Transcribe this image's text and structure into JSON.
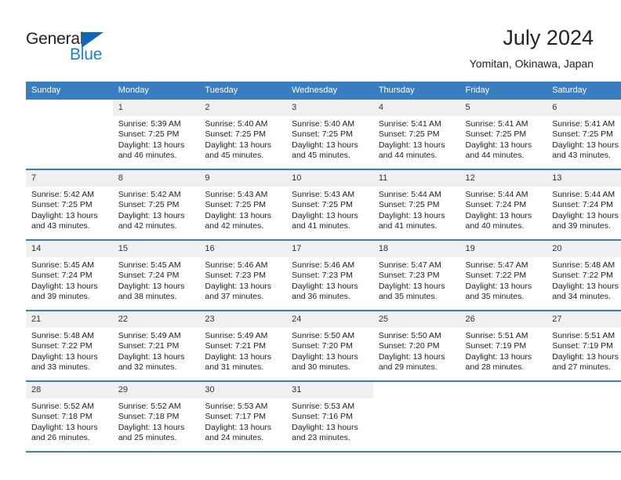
{
  "brand": {
    "name_dark": "General",
    "name_light": "Blue",
    "triangle_color": "#1267b2",
    "light_color": "#1f7fd4"
  },
  "header": {
    "title": "July 2024",
    "subtitle": "Yomitan, Okinawa, Japan"
  },
  "theme": {
    "header_blue": "#3a7dc0",
    "daynum_band": "#f0f0f0",
    "text": "#222222"
  },
  "weekdays": [
    "Sunday",
    "Monday",
    "Tuesday",
    "Wednesday",
    "Thursday",
    "Friday",
    "Saturday"
  ],
  "weeks": [
    [
      {
        "day": "",
        "blank": true,
        "sunrise": "",
        "sunset": "",
        "daylight1": "",
        "daylight2": ""
      },
      {
        "day": "1",
        "sunrise": "Sunrise: 5:39 AM",
        "sunset": "Sunset: 7:25 PM",
        "daylight1": "Daylight: 13 hours",
        "daylight2": "and 46 minutes."
      },
      {
        "day": "2",
        "sunrise": "Sunrise: 5:40 AM",
        "sunset": "Sunset: 7:25 PM",
        "daylight1": "Daylight: 13 hours",
        "daylight2": "and 45 minutes."
      },
      {
        "day": "3",
        "sunrise": "Sunrise: 5:40 AM",
        "sunset": "Sunset: 7:25 PM",
        "daylight1": "Daylight: 13 hours",
        "daylight2": "and 45 minutes."
      },
      {
        "day": "4",
        "sunrise": "Sunrise: 5:41 AM",
        "sunset": "Sunset: 7:25 PM",
        "daylight1": "Daylight: 13 hours",
        "daylight2": "and 44 minutes."
      },
      {
        "day": "5",
        "sunrise": "Sunrise: 5:41 AM",
        "sunset": "Sunset: 7:25 PM",
        "daylight1": "Daylight: 13 hours",
        "daylight2": "and 44 minutes."
      },
      {
        "day": "6",
        "sunrise": "Sunrise: 5:41 AM",
        "sunset": "Sunset: 7:25 PM",
        "daylight1": "Daylight: 13 hours",
        "daylight2": "and 43 minutes."
      }
    ],
    [
      {
        "day": "7",
        "sunrise": "Sunrise: 5:42 AM",
        "sunset": "Sunset: 7:25 PM",
        "daylight1": "Daylight: 13 hours",
        "daylight2": "and 43 minutes."
      },
      {
        "day": "8",
        "sunrise": "Sunrise: 5:42 AM",
        "sunset": "Sunset: 7:25 PM",
        "daylight1": "Daylight: 13 hours",
        "daylight2": "and 42 minutes."
      },
      {
        "day": "9",
        "sunrise": "Sunrise: 5:43 AM",
        "sunset": "Sunset: 7:25 PM",
        "daylight1": "Daylight: 13 hours",
        "daylight2": "and 42 minutes."
      },
      {
        "day": "10",
        "sunrise": "Sunrise: 5:43 AM",
        "sunset": "Sunset: 7:25 PM",
        "daylight1": "Daylight: 13 hours",
        "daylight2": "and 41 minutes."
      },
      {
        "day": "11",
        "sunrise": "Sunrise: 5:44 AM",
        "sunset": "Sunset: 7:25 PM",
        "daylight1": "Daylight: 13 hours",
        "daylight2": "and 41 minutes."
      },
      {
        "day": "12",
        "sunrise": "Sunrise: 5:44 AM",
        "sunset": "Sunset: 7:24 PM",
        "daylight1": "Daylight: 13 hours",
        "daylight2": "and 40 minutes."
      },
      {
        "day": "13",
        "sunrise": "Sunrise: 5:44 AM",
        "sunset": "Sunset: 7:24 PM",
        "daylight1": "Daylight: 13 hours",
        "daylight2": "and 39 minutes."
      }
    ],
    [
      {
        "day": "14",
        "sunrise": "Sunrise: 5:45 AM",
        "sunset": "Sunset: 7:24 PM",
        "daylight1": "Daylight: 13 hours",
        "daylight2": "and 39 minutes."
      },
      {
        "day": "15",
        "sunrise": "Sunrise: 5:45 AM",
        "sunset": "Sunset: 7:24 PM",
        "daylight1": "Daylight: 13 hours",
        "daylight2": "and 38 minutes."
      },
      {
        "day": "16",
        "sunrise": "Sunrise: 5:46 AM",
        "sunset": "Sunset: 7:23 PM",
        "daylight1": "Daylight: 13 hours",
        "daylight2": "and 37 minutes."
      },
      {
        "day": "17",
        "sunrise": "Sunrise: 5:46 AM",
        "sunset": "Sunset: 7:23 PM",
        "daylight1": "Daylight: 13 hours",
        "daylight2": "and 36 minutes."
      },
      {
        "day": "18",
        "sunrise": "Sunrise: 5:47 AM",
        "sunset": "Sunset: 7:23 PM",
        "daylight1": "Daylight: 13 hours",
        "daylight2": "and 35 minutes."
      },
      {
        "day": "19",
        "sunrise": "Sunrise: 5:47 AM",
        "sunset": "Sunset: 7:22 PM",
        "daylight1": "Daylight: 13 hours",
        "daylight2": "and 35 minutes."
      },
      {
        "day": "20",
        "sunrise": "Sunrise: 5:48 AM",
        "sunset": "Sunset: 7:22 PM",
        "daylight1": "Daylight: 13 hours",
        "daylight2": "and 34 minutes."
      }
    ],
    [
      {
        "day": "21",
        "sunrise": "Sunrise: 5:48 AM",
        "sunset": "Sunset: 7:22 PM",
        "daylight1": "Daylight: 13 hours",
        "daylight2": "and 33 minutes."
      },
      {
        "day": "22",
        "sunrise": "Sunrise: 5:49 AM",
        "sunset": "Sunset: 7:21 PM",
        "daylight1": "Daylight: 13 hours",
        "daylight2": "and 32 minutes."
      },
      {
        "day": "23",
        "sunrise": "Sunrise: 5:49 AM",
        "sunset": "Sunset: 7:21 PM",
        "daylight1": "Daylight: 13 hours",
        "daylight2": "and 31 minutes."
      },
      {
        "day": "24",
        "sunrise": "Sunrise: 5:50 AM",
        "sunset": "Sunset: 7:20 PM",
        "daylight1": "Daylight: 13 hours",
        "daylight2": "and 30 minutes."
      },
      {
        "day": "25",
        "sunrise": "Sunrise: 5:50 AM",
        "sunset": "Sunset: 7:20 PM",
        "daylight1": "Daylight: 13 hours",
        "daylight2": "and 29 minutes."
      },
      {
        "day": "26",
        "sunrise": "Sunrise: 5:51 AM",
        "sunset": "Sunset: 7:19 PM",
        "daylight1": "Daylight: 13 hours",
        "daylight2": "and 28 minutes."
      },
      {
        "day": "27",
        "sunrise": "Sunrise: 5:51 AM",
        "sunset": "Sunset: 7:19 PM",
        "daylight1": "Daylight: 13 hours",
        "daylight2": "and 27 minutes."
      }
    ],
    [
      {
        "day": "28",
        "sunrise": "Sunrise: 5:52 AM",
        "sunset": "Sunset: 7:18 PM",
        "daylight1": "Daylight: 13 hours",
        "daylight2": "and 26 minutes."
      },
      {
        "day": "29",
        "sunrise": "Sunrise: 5:52 AM",
        "sunset": "Sunset: 7:18 PM",
        "daylight1": "Daylight: 13 hours",
        "daylight2": "and 25 minutes."
      },
      {
        "day": "30",
        "sunrise": "Sunrise: 5:53 AM",
        "sunset": "Sunset: 7:17 PM",
        "daylight1": "Daylight: 13 hours",
        "daylight2": "and 24 minutes."
      },
      {
        "day": "31",
        "sunrise": "Sunrise: 5:53 AM",
        "sunset": "Sunset: 7:16 PM",
        "daylight1": "Daylight: 13 hours",
        "daylight2": "and 23 minutes."
      },
      {
        "day": "",
        "blank": true,
        "sunrise": "",
        "sunset": "",
        "daylight1": "",
        "daylight2": ""
      },
      {
        "day": "",
        "blank": true,
        "sunrise": "",
        "sunset": "",
        "daylight1": "",
        "daylight2": ""
      },
      {
        "day": "",
        "blank": true,
        "sunrise": "",
        "sunset": "",
        "daylight1": "",
        "daylight2": ""
      }
    ]
  ]
}
